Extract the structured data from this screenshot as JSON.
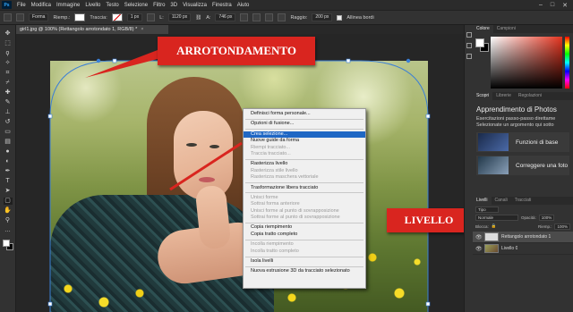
{
  "menubar": {
    "logo": "Ps",
    "items": [
      "File",
      "Modifica",
      "Immagine",
      "Livello",
      "Testo",
      "Selezione",
      "Filtro",
      "3D",
      "Visualizza",
      "Finestra",
      "Aiuto"
    ]
  },
  "options": {
    "mode": "Forma",
    "fill_label": "Riemp.:",
    "stroke_label": "Traccia:",
    "stroke_size": "1 px",
    "w_label": "L:",
    "w_value": "1120 px",
    "h_label": "A:",
    "h_value": "746 px",
    "radius_label": "Raggio:",
    "radius_value": "200 px",
    "align_label": "Allinea bordi"
  },
  "document": {
    "tab_title": "girl1.jpg @ 100% (Rettangolo arrotondato 1, RGB/8) *",
    "close": "×"
  },
  "callouts": {
    "top": "ARROTONDAMENTO",
    "right": "LIVELLO"
  },
  "context_menu": {
    "items": [
      {
        "label": "Definisci forma personale...",
        "state": "enabled"
      },
      {
        "sep": true
      },
      {
        "label": "Opzioni di fusione...",
        "state": "enabled"
      },
      {
        "sep": true
      },
      {
        "label": "Crea selezione...",
        "state": "highlighted"
      },
      {
        "label": "Nuove guide da forma",
        "state": "enabled"
      },
      {
        "label": "Riempi tracciato...",
        "state": "disabled"
      },
      {
        "label": "Traccia tracciato...",
        "state": "disabled"
      },
      {
        "sep": true
      },
      {
        "label": "Rasterizza livello",
        "state": "enabled"
      },
      {
        "label": "Rasterizza stile livello",
        "state": "disabled"
      },
      {
        "label": "Rasterizza maschera vettoriale",
        "state": "disabled"
      },
      {
        "sep": true
      },
      {
        "label": "Trasformazione libera tracciato",
        "state": "enabled"
      },
      {
        "sep": true
      },
      {
        "label": "Unisci forme",
        "state": "disabled"
      },
      {
        "label": "Sottrai forma anteriore",
        "state": "disabled"
      },
      {
        "label": "Unisci forme al punto di sovrapposizione",
        "state": "disabled"
      },
      {
        "label": "Sottrai forme al punto di sovrapposizione",
        "state": "disabled"
      },
      {
        "sep": true
      },
      {
        "label": "Copia riempimento",
        "state": "enabled"
      },
      {
        "label": "Copia tratto completo",
        "state": "enabled"
      },
      {
        "sep": true
      },
      {
        "label": "Incolla riempimento",
        "state": "disabled"
      },
      {
        "label": "Incolla tratto completo",
        "state": "disabled"
      },
      {
        "sep": true
      },
      {
        "label": "Isola livelli",
        "state": "enabled"
      },
      {
        "sep": true
      },
      {
        "label": "Nuova estrusione 3D da tracciato selezionato",
        "state": "enabled"
      }
    ]
  },
  "panels": {
    "color_tabs": [
      "Colore",
      "Campioni"
    ],
    "learn_tabs": [
      "Scopri",
      "Librerie",
      "Regolazioni"
    ],
    "learn_title": "Apprendimento di Photos",
    "learn_sub1": "Esercitazioni passo-passo direttame",
    "learn_sub2": "Selezionate un argomento qui sotto",
    "cards": [
      "Funzioni di base",
      "Correggere una foto"
    ],
    "layer_tabs": [
      "Livelli",
      "Canali",
      "Tracciati"
    ],
    "kind": "Tipo",
    "blend": "Normale",
    "opacity_label": "Opacità:",
    "opacity_value": "100%",
    "lock_label": "Blocca:",
    "fill_label": "Riemp.:",
    "fill_value": "100%",
    "layers": [
      {
        "name": "Rettangolo arrotondato 1",
        "active": true
      },
      {
        "name": "Livello 0",
        "active": false
      }
    ]
  },
  "colors": {
    "callout": "#d9251f",
    "menu_highlight": "#1f67c4",
    "panel_bg": "#323232"
  },
  "icons": [
    "move-icon",
    "marquee-icon",
    "lasso-icon",
    "magic-wand-icon",
    "crop-icon",
    "eyedropper-icon",
    "heal-icon",
    "brush-icon",
    "stamp-icon",
    "history-brush-icon",
    "eraser-icon",
    "gradient-icon",
    "blur-icon",
    "dodge-icon",
    "pen-icon",
    "type-icon",
    "path-select-icon",
    "shape-icon",
    "hand-icon",
    "zoom-icon",
    "more-icon"
  ]
}
